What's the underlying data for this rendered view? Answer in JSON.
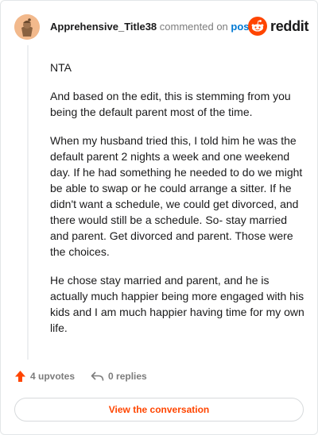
{
  "header": {
    "username": "Apprehensive_Title38",
    "commented_on": "commented on",
    "post_link": "post",
    "brand": "reddit"
  },
  "comment": {
    "paragraphs": [
      "NTA",
      "And based on the edit, this is stemming from you being the default parent most of the time.",
      "When my husband tried this, I told him he was the default parent 2 nights a week and one weekend day. If he had something he needed to do we might be able to swap or he could arrange a sitter. If he didn't want a schedule, we could get divorced, and there would still be a schedule. So- stay married and parent. Get divorced and parent. Those were the choices.",
      "He chose stay married and parent, and he is actually much happier being more engaged with his kids and I am much happier having time for my own life."
    ]
  },
  "actions": {
    "upvotes": "4 upvotes",
    "replies": "0 replies"
  },
  "button": {
    "view_conversation": "View the conversation"
  },
  "colors": {
    "accent": "#ff4500",
    "link": "#0079d3",
    "muted": "#7c7c7c"
  },
  "icons": {
    "avatar": "snoo-avatar",
    "logo": "reddit-logo-icon",
    "upvote": "upvote-arrow-icon",
    "reply": "reply-arrow-icon"
  }
}
